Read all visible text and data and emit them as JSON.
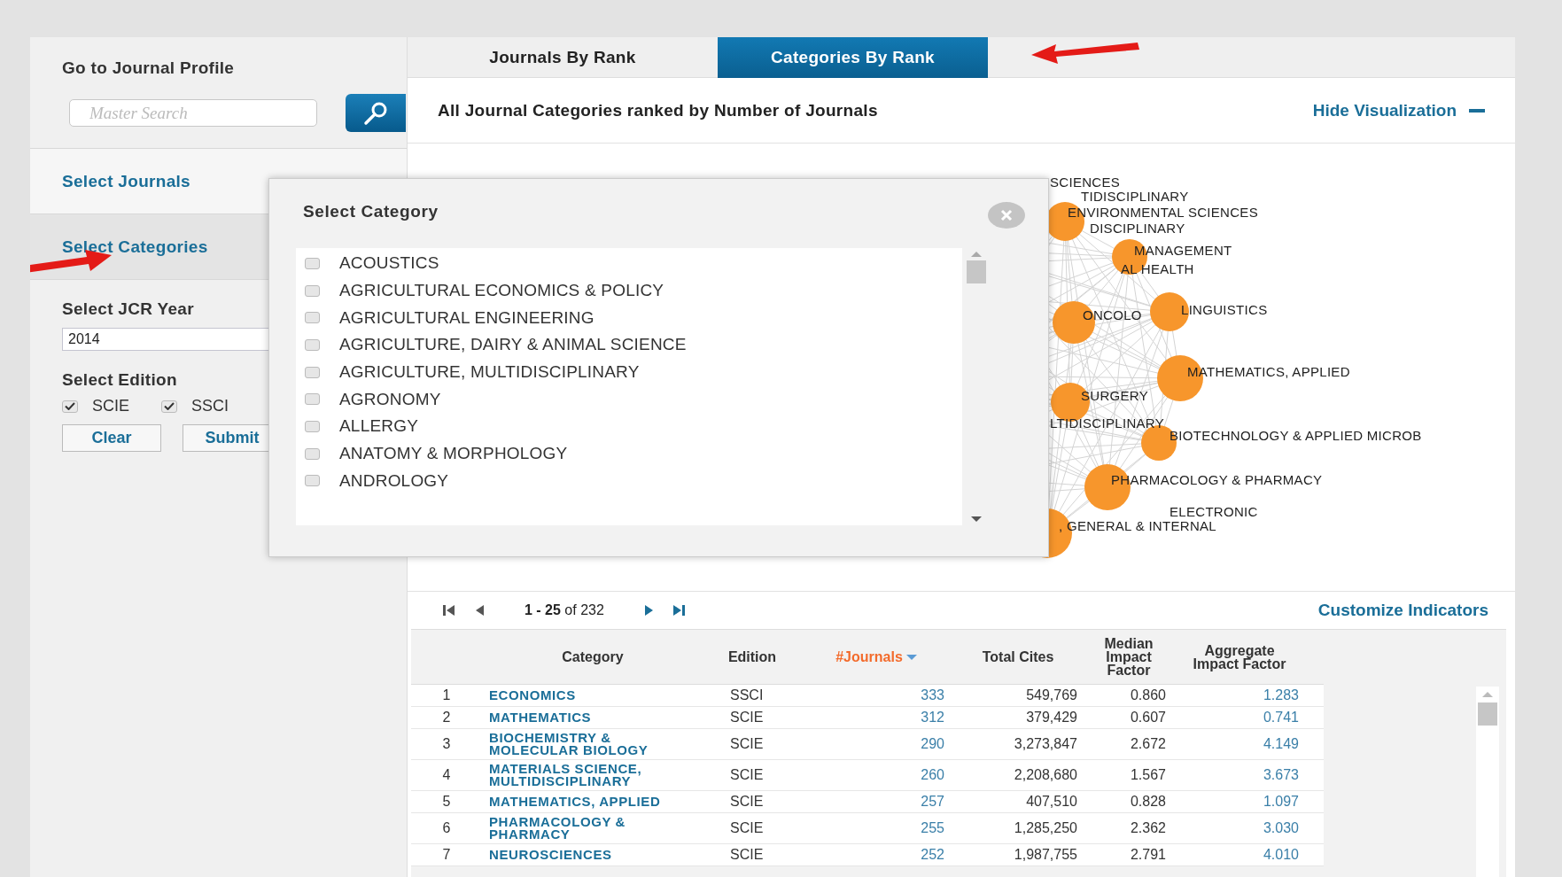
{
  "sidebar": {
    "profile_title": "Go to Journal Profile",
    "search": {
      "placeholder": "Master Search"
    },
    "sections": [
      {
        "label": "Select Journals",
        "selected": false
      },
      {
        "label": "Select Categories",
        "selected": true
      }
    ],
    "year": {
      "label": "Select JCR Year",
      "value": "2014"
    },
    "edition": {
      "label": "Select Edition",
      "options": [
        {
          "label": "SCIE",
          "checked": true
        },
        {
          "label": "SSCI",
          "checked": true
        }
      ]
    },
    "buttons": [
      "Clear",
      "Submit"
    ]
  },
  "tabs": [
    {
      "label": "Journals By Rank",
      "selected": false
    },
    {
      "label": "Categories By Rank",
      "selected": true
    }
  ],
  "header": {
    "title": "All Journal Categories ranked by Number of Journals",
    "toggle": "Hide Visualization"
  },
  "visualization": {
    "items": [
      {
        "kind": "label",
        "label": "SCIENCES"
      },
      {
        "kind": "label",
        "label": "TIDISCIPLINARY"
      },
      {
        "kind": "node",
        "label": "ENVIRONMENTAL SCIENCES"
      },
      {
        "kind": "label",
        "label": "DISCIPLINARY"
      },
      {
        "kind": "node",
        "label": "MANAGEMENT"
      },
      {
        "kind": "label",
        "label": "AL HEALTH"
      },
      {
        "kind": "node",
        "label": "ONCOLO"
      },
      {
        "kind": "node",
        "label": "LINGUISTICS"
      },
      {
        "kind": "node",
        "label": "MATHEMATICS, APPLIED"
      },
      {
        "kind": "node",
        "label": "SURGERY"
      },
      {
        "kind": "label",
        "label": "LTIDISCIPLINARY"
      },
      {
        "kind": "node",
        "label": "BIOTECHNOLOGY & APPLIED MICROB"
      },
      {
        "kind": "node",
        "label": "PHARMACOLOGY & PHARMACY"
      },
      {
        "kind": "label",
        "label": "ELECTRONIC"
      },
      {
        "kind": "node",
        "label": ", GENERAL & INTERNAL"
      }
    ]
  },
  "modal": {
    "title": "Select Category",
    "items": [
      {
        "label": "ACOUSTICS",
        "checked": false
      },
      {
        "label": "AGRICULTURAL ECONOMICS & POLICY",
        "checked": false
      },
      {
        "label": "AGRICULTURAL ENGINEERING",
        "checked": false
      },
      {
        "label": "AGRICULTURE, DAIRY & ANIMAL SCIENCE",
        "checked": false
      },
      {
        "label": "AGRICULTURE, MULTIDISCIPLINARY",
        "checked": false
      },
      {
        "label": "AGRONOMY",
        "checked": false
      },
      {
        "label": "ALLERGY",
        "checked": false
      },
      {
        "label": "ANATOMY & MORPHOLOGY",
        "checked": false
      },
      {
        "label": "ANDROLOGY",
        "checked": false
      }
    ]
  },
  "pager": {
    "range": "**1 - 25** of 232",
    "link": "Customize Indicators"
  },
  "table": {
    "columns": [
      {
        "label": "Category",
        "sorted": false
      },
      {
        "label": "Edition",
        "sorted": false
      },
      {
        "label": "#Journals",
        "sorted": true
      },
      {
        "label": "Total Cites",
        "sorted": false
      },
      {
        "label": "Median Impact Factor",
        "sorted": false
      },
      {
        "label": "Aggregate Impact Factor",
        "sorted": false
      }
    ],
    "rows": [
      {
        "rank": "1",
        "cells": [
          "ECONOMICS",
          "SSCI",
          "333",
          "549,769",
          "0.860",
          "1.283"
        ]
      },
      {
        "rank": "2",
        "cells": [
          "MATHEMATICS",
          "SCIE",
          "312",
          "379,429",
          "0.607",
          "0.741"
        ]
      },
      {
        "rank": "3",
        "cells": [
          "BIOCHEMISTRY & MOLECULAR BIOLOGY",
          "SCIE",
          "290",
          "3,273,847",
          "2.672",
          "4.149"
        ]
      },
      {
        "rank": "4",
        "cells": [
          "MATERIALS SCIENCE, MULTIDISCIPLINARY",
          "SCIE",
          "260",
          "2,208,680",
          "1.567",
          "3.673"
        ]
      },
      {
        "rank": "5",
        "cells": [
          "MATHEMATICS, APPLIED",
          "SCIE",
          "257",
          "407,510",
          "0.828",
          "1.097"
        ]
      },
      {
        "rank": "6",
        "cells": [
          "PHARMACOLOGY & PHARMACY",
          "SCIE",
          "255",
          "1,285,250",
          "2.362",
          "3.030"
        ]
      },
      {
        "rank": "7",
        "cells": [
          "NEUROSCIENCES",
          "SCIE",
          "252",
          "1,987,755",
          "2.791",
          "4.010"
        ]
      }
    ]
  }
}
